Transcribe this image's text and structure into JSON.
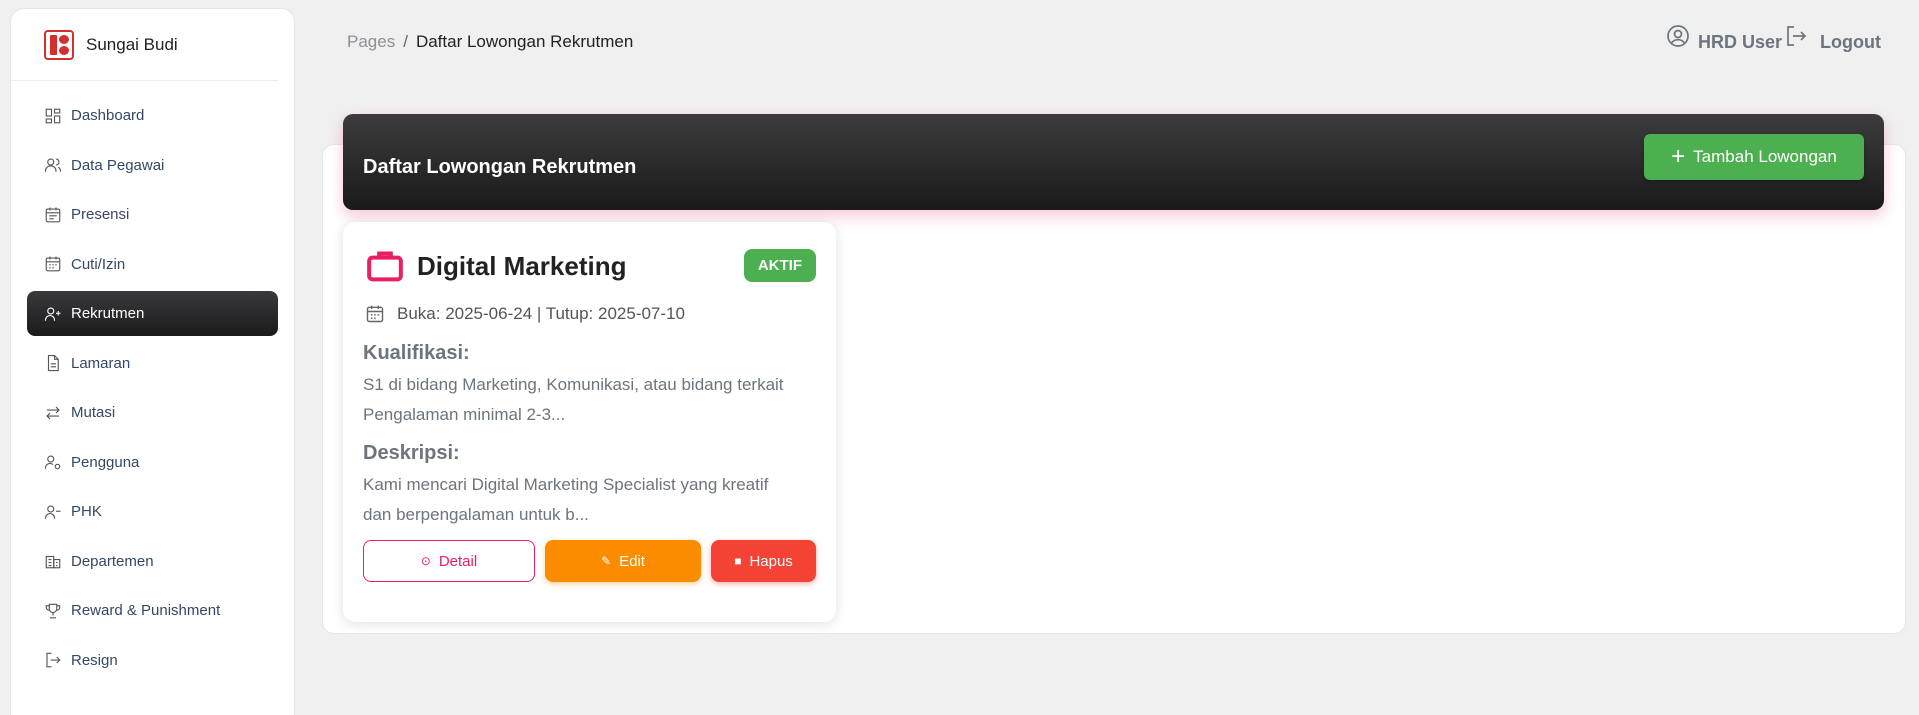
{
  "brand": {
    "name": "Sungai Budi"
  },
  "sidebar": {
    "items": [
      {
        "label": "Dashboard",
        "icon": "dashboard-icon"
      },
      {
        "label": "Data Pegawai",
        "icon": "users-icon"
      },
      {
        "label": "Presensi",
        "icon": "calendar-icon"
      },
      {
        "label": "Cuti/Izin",
        "icon": "calendar-grid-icon"
      },
      {
        "label": "Rekrutmen",
        "icon": "user-plus-icon",
        "active": true
      },
      {
        "label": "Lamaran",
        "icon": "document-icon"
      },
      {
        "label": "Mutasi",
        "icon": "swap-icon"
      },
      {
        "label": "Pengguna",
        "icon": "user-gear-icon"
      },
      {
        "label": "PHK",
        "icon": "user-minus-icon"
      },
      {
        "label": "Departemen",
        "icon": "building-icon"
      },
      {
        "label": "Reward & Punishment",
        "icon": "trophy-icon"
      },
      {
        "label": "Resign",
        "icon": "sign-out-icon"
      }
    ]
  },
  "breadcrumb": {
    "root": "Pages",
    "separator": "/",
    "current": "Daftar Lowongan Rekrutmen"
  },
  "topbar": {
    "user": "HRD User",
    "logout": "Logout"
  },
  "header": {
    "title": "Daftar Lowongan Rekrutmen",
    "add_button": "Tambah Lowongan"
  },
  "jobs": [
    {
      "title": "Digital Marketing",
      "status": "AKTIF",
      "dates": "Buka: 2025-06-24 | Tutup: 2025-07-10",
      "qual_title": "Kualifikasi:",
      "qual_text": "S1 di bidang Marketing, Komunikasi, atau bidang terkait\nPengalaman minimal 2-3...",
      "desc_title": "Deskripsi:",
      "desc_text": "Kami mencari Digital Marketing Specialist yang kreatif\ndan berpengalaman untuk b...",
      "detail_label": "Detail",
      "edit_label": "Edit",
      "delete_label": "Hapus"
    }
  ],
  "colors": {
    "accent": "#e91e63",
    "success": "#4caf50",
    "warning": "#fb8c00",
    "danger": "#f44335",
    "dark": "#1b1b1c"
  }
}
